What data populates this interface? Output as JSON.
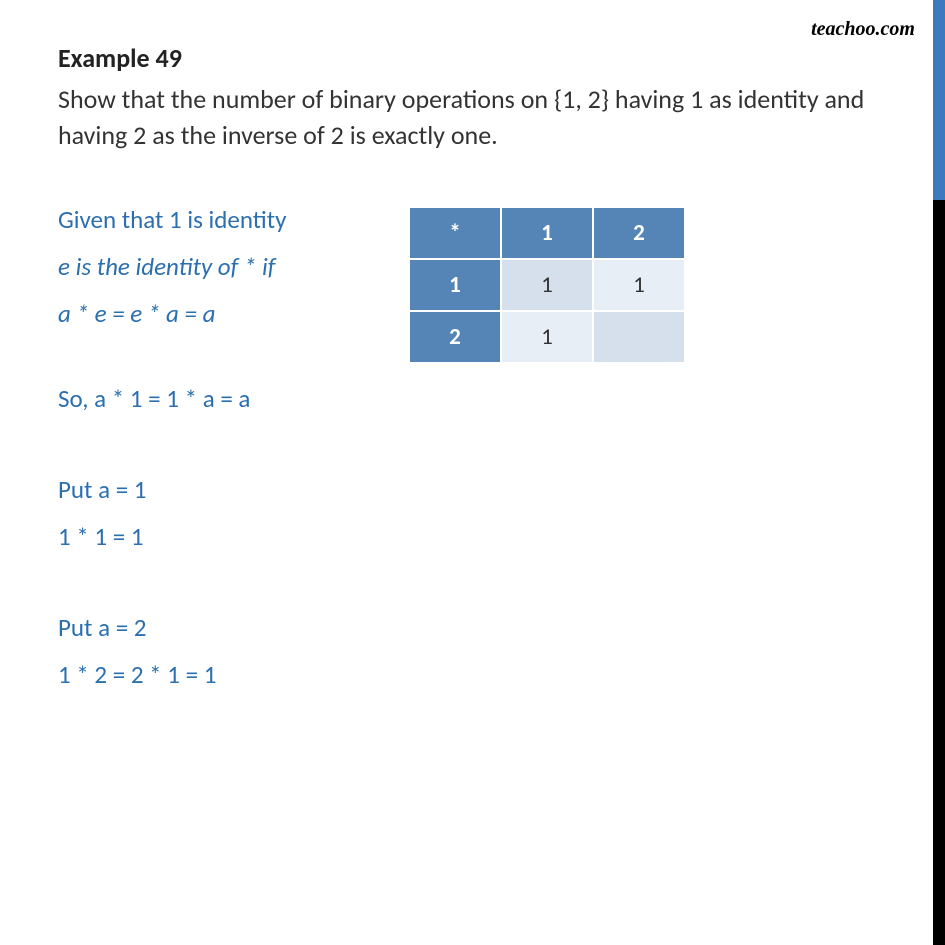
{
  "watermark": "teachoo.com",
  "title": {
    "label": "Example 49"
  },
  "problem": "Show that the number of binary operations on {1, 2} having 1 as identity and having 2 as the inverse of 2 is exactly one.",
  "lines": {
    "given": "Given that 1 is identity",
    "def": "e is the identity of * if",
    "eq1": "a * e  = e * a = a",
    "so": "So, a * 1 = 1 * a = a",
    "put1": "Put a = 1",
    "res1": "1 * 1 = 1",
    "put2": "Put a = 2",
    "res2": "1 * 2 = 2 * 1 = 1"
  },
  "table": {
    "h0": "*",
    "h1": "1",
    "h2": "2",
    "r1h": "1",
    "r1c1": "1",
    "r1c2": "1",
    "r2h": "2",
    "r2c1": "1",
    "r2c2": ""
  }
}
